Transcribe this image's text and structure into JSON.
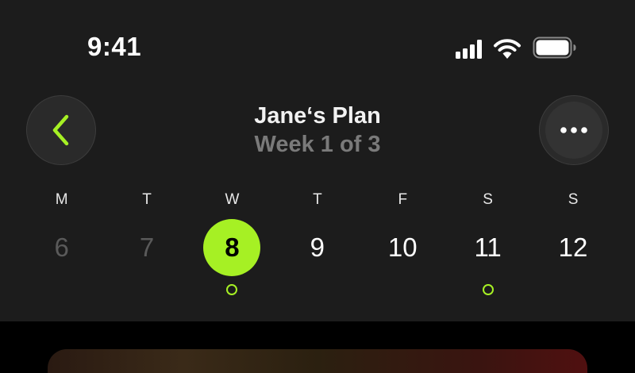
{
  "status_bar": {
    "time": "9:41",
    "icons": [
      "cellular-signal-icon",
      "wifi-icon",
      "battery-icon"
    ]
  },
  "header": {
    "title": "Jane‘s Plan",
    "subtitle": "Week 1 of 3",
    "back_icon": "chevron-left-icon",
    "more_icon": "ellipsis-icon"
  },
  "colors": {
    "accent": "#a6f024",
    "panel": "#1c1c1c",
    "background": "#000000",
    "muted_text": "#7a7a7a"
  },
  "week": {
    "days": [
      {
        "letter": "M",
        "number": "6",
        "state": "past",
        "has_workout": false
      },
      {
        "letter": "T",
        "number": "7",
        "state": "past",
        "has_workout": false
      },
      {
        "letter": "W",
        "number": "8",
        "state": "selected",
        "has_workout": true
      },
      {
        "letter": "T",
        "number": "9",
        "state": "upcoming",
        "has_workout": false
      },
      {
        "letter": "F",
        "number": "10",
        "state": "upcoming",
        "has_workout": false
      },
      {
        "letter": "S",
        "number": "11",
        "state": "upcoming",
        "has_workout": true
      },
      {
        "letter": "S",
        "number": "12",
        "state": "upcoming",
        "has_workout": false
      }
    ]
  }
}
